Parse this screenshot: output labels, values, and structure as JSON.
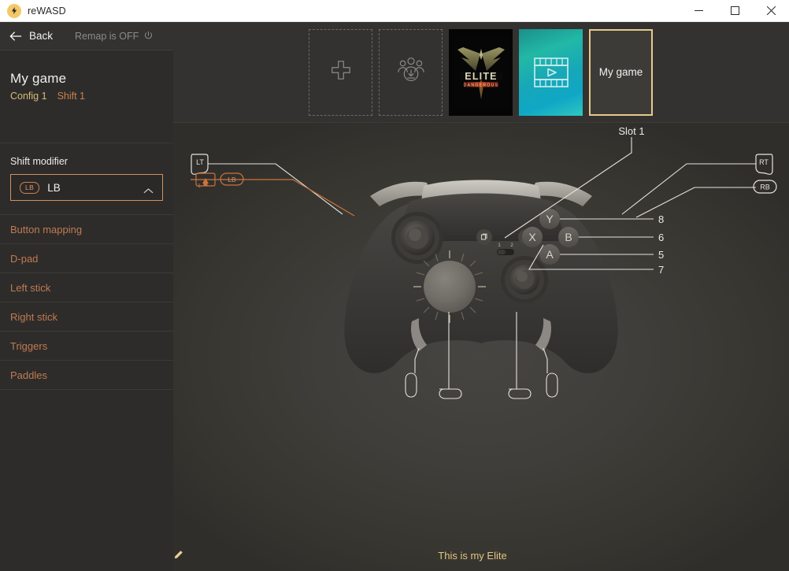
{
  "window": {
    "title": "reWASD",
    "logo_icon": "bolt-icon",
    "controls": {
      "minimize": "minimize-icon",
      "maximize": "maximize-icon",
      "close": "close-icon"
    }
  },
  "sidebar": {
    "back": {
      "label": "Back",
      "icon": "arrow-left-icon"
    },
    "remap": {
      "label": "Remap is OFF",
      "icon": "power-icon"
    },
    "game": {
      "name": "My game",
      "config": "Config 1",
      "shift": "Shift 1"
    },
    "shift_modifier": {
      "title": "Shift modifier",
      "chip": "LB",
      "value": "LB",
      "caret_icon": "chevron-up-icon"
    },
    "menu": [
      {
        "label": "Button mapping"
      },
      {
        "label": "D-pad"
      },
      {
        "label": "Left stick"
      },
      {
        "label": "Right stick"
      },
      {
        "label": "Triggers"
      },
      {
        "label": "Paddles"
      }
    ]
  },
  "tabs": [
    {
      "type": "add",
      "icon": "plus-icon",
      "label": ""
    },
    {
      "type": "community",
      "icon": "community-download-icon",
      "label": ""
    },
    {
      "type": "game",
      "icon": "elite-dangerous-cover",
      "label": ""
    },
    {
      "type": "video",
      "icon": "film-play-icon",
      "label": ""
    },
    {
      "type": "selected",
      "icon": "",
      "label": "My game"
    }
  ],
  "controller": {
    "slot_label": "Slot 1",
    "slot_switch": {
      "left": "1",
      "right": "2"
    },
    "buttons": {
      "lt": "LT",
      "rt": "RT",
      "lb": "LB",
      "rb": "RB"
    },
    "shift_badge": {
      "number": "1",
      "icon": "shift-up-icon"
    },
    "face_buttons": [
      {
        "name": "Y",
        "mapping": "8"
      },
      {
        "name": "B",
        "mapping": "6"
      },
      {
        "name": "A",
        "mapping": "5"
      },
      {
        "name": "X",
        "mapping": "7"
      }
    ],
    "center_buttons": {
      "view": "view-icon",
      "menu": "menu-icon"
    }
  },
  "footer": {
    "text": "This is my Elite",
    "edit_icon": "pencil-icon"
  },
  "colors": {
    "accent_orange": "#cf7f4f",
    "accent_gold": "#e2c483",
    "selection_border": "#e8c98b",
    "sidebar_bg": "#2d2c2a",
    "stage_bg": "#3a3835"
  }
}
